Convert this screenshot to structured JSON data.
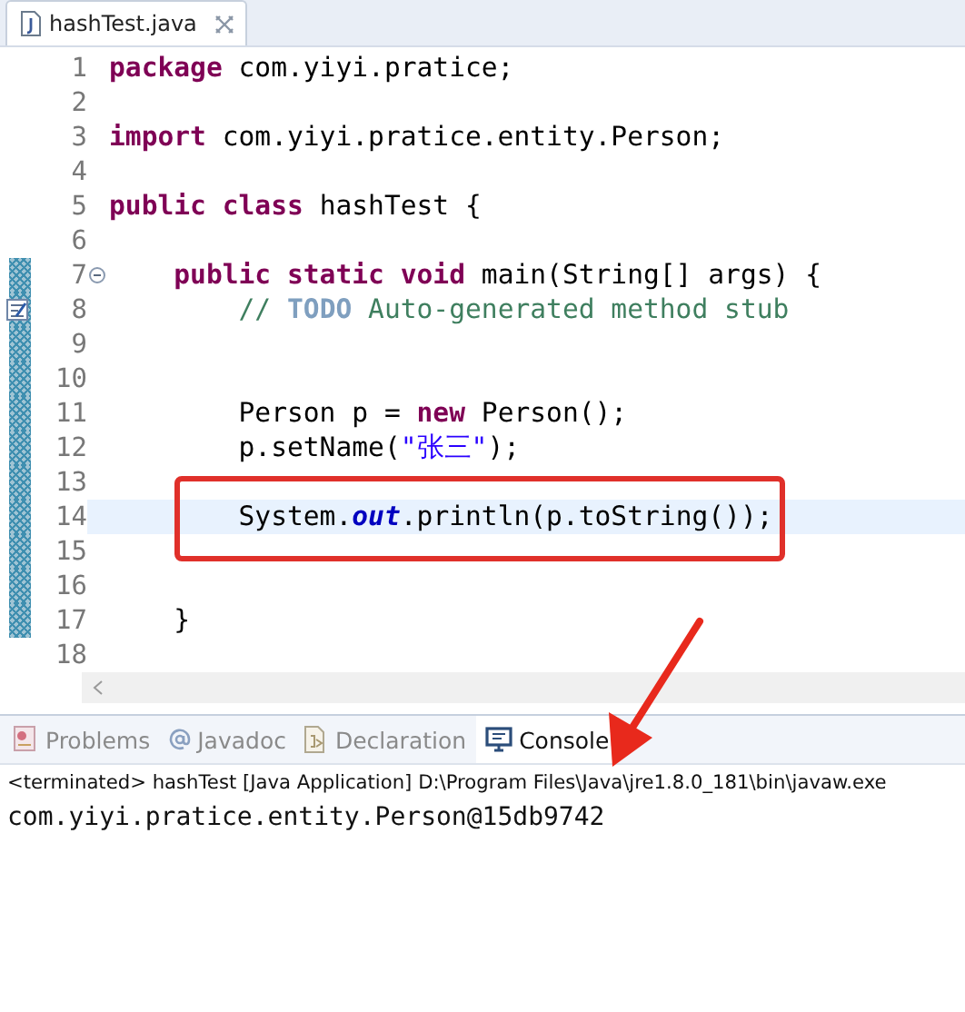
{
  "editor": {
    "tab": {
      "label": "hashTest.java",
      "selected": true
    },
    "lines": [
      {
        "number": "1",
        "marked": false,
        "current": false,
        "boxed": false,
        "tokens": [
          {
            "kind": "keyword",
            "text": "package"
          },
          {
            "kind": "plain",
            "text": " com.yiyi.pratice;"
          }
        ]
      },
      {
        "number": "2",
        "marked": false,
        "current": false,
        "boxed": false
      },
      {
        "number": "3",
        "marked": false,
        "current": false,
        "boxed": false,
        "tokens": [
          {
            "kind": "keyword",
            "text": "import"
          },
          {
            "kind": "plain",
            "text": " com.yiyi.pratice.entity.Person;"
          }
        ]
      },
      {
        "number": "4",
        "marked": false,
        "current": false,
        "boxed": false
      },
      {
        "number": "5",
        "marked": false,
        "current": false,
        "boxed": false,
        "tokens": [
          {
            "kind": "keyword",
            "text": "public class"
          },
          {
            "kind": "plain",
            "text": " hashTest {"
          }
        ]
      },
      {
        "number": "6",
        "marked": false,
        "current": false,
        "boxed": false
      },
      {
        "number": "7",
        "marked": true,
        "current": false,
        "boxed": false,
        "expanded": true,
        "tokens": [
          {
            "kind": "keyword",
            "text": "    public static void"
          },
          {
            "kind": "plain",
            "text": " main(String[] args) {"
          }
        ]
      },
      {
        "number": "8",
        "marked": true,
        "current": false,
        "boxed": false,
        "task_marker": true,
        "tokens": [
          {
            "kind": "comment",
            "text": "        // "
          },
          {
            "kind": "todo",
            "text": "TODO"
          },
          {
            "kind": "comment",
            "text": " Auto-generated method stub"
          }
        ]
      },
      {
        "number": "9",
        "marked": true,
        "current": false,
        "boxed": false
      },
      {
        "number": "10",
        "marked": true,
        "current": false,
        "boxed": false
      },
      {
        "number": "11",
        "marked": true,
        "current": false,
        "boxed": false,
        "tokens": [
          {
            "kind": "plain",
            "text": "        Person p = "
          },
          {
            "kind": "keyword",
            "text": "new"
          },
          {
            "kind": "plain",
            "text": " Person();"
          }
        ]
      },
      {
        "number": "12",
        "marked": true,
        "current": false,
        "boxed": false,
        "tokens": [
          {
            "kind": "plain",
            "text": "        p.setName("
          },
          {
            "kind": "string",
            "text": "\"张三\""
          },
          {
            "kind": "plain",
            "text": ");"
          }
        ]
      },
      {
        "number": "13",
        "marked": true,
        "current": false,
        "boxed": false
      },
      {
        "number": "14",
        "marked": true,
        "current": true,
        "boxed": true,
        "tokens": [
          {
            "kind": "plain",
            "text": "        System."
          },
          {
            "kind": "field",
            "text": "out"
          },
          {
            "kind": "plain",
            "text": ".println(p.toString());"
          }
        ]
      },
      {
        "number": "15",
        "marked": true,
        "current": false,
        "boxed": false
      },
      {
        "number": "16",
        "marked": true,
        "current": false,
        "boxed": false
      },
      {
        "number": "17",
        "marked": true,
        "current": false,
        "boxed": false,
        "tokens": [
          {
            "kind": "plain",
            "text": "    }"
          }
        ]
      },
      {
        "number": "18",
        "marked": false,
        "current": false,
        "boxed": false
      }
    ]
  },
  "bottom_panel": {
    "tabs": [
      {
        "label": "Problems",
        "kind": "problems",
        "selected": false
      },
      {
        "label": "Javadoc",
        "kind": "javadoc",
        "selected": false
      },
      {
        "label": "Declaration",
        "kind": "declaration",
        "selected": false
      },
      {
        "label": "Console",
        "kind": "console",
        "selected": true
      }
    ],
    "console": {
      "header": "<terminated> hashTest [Java Application] D:\\Program Files\\Java\\jre1.8.0_181\\bin\\javaw.exe",
      "output": "com.yiyi.pratice.entity.Person@15db9742"
    }
  }
}
